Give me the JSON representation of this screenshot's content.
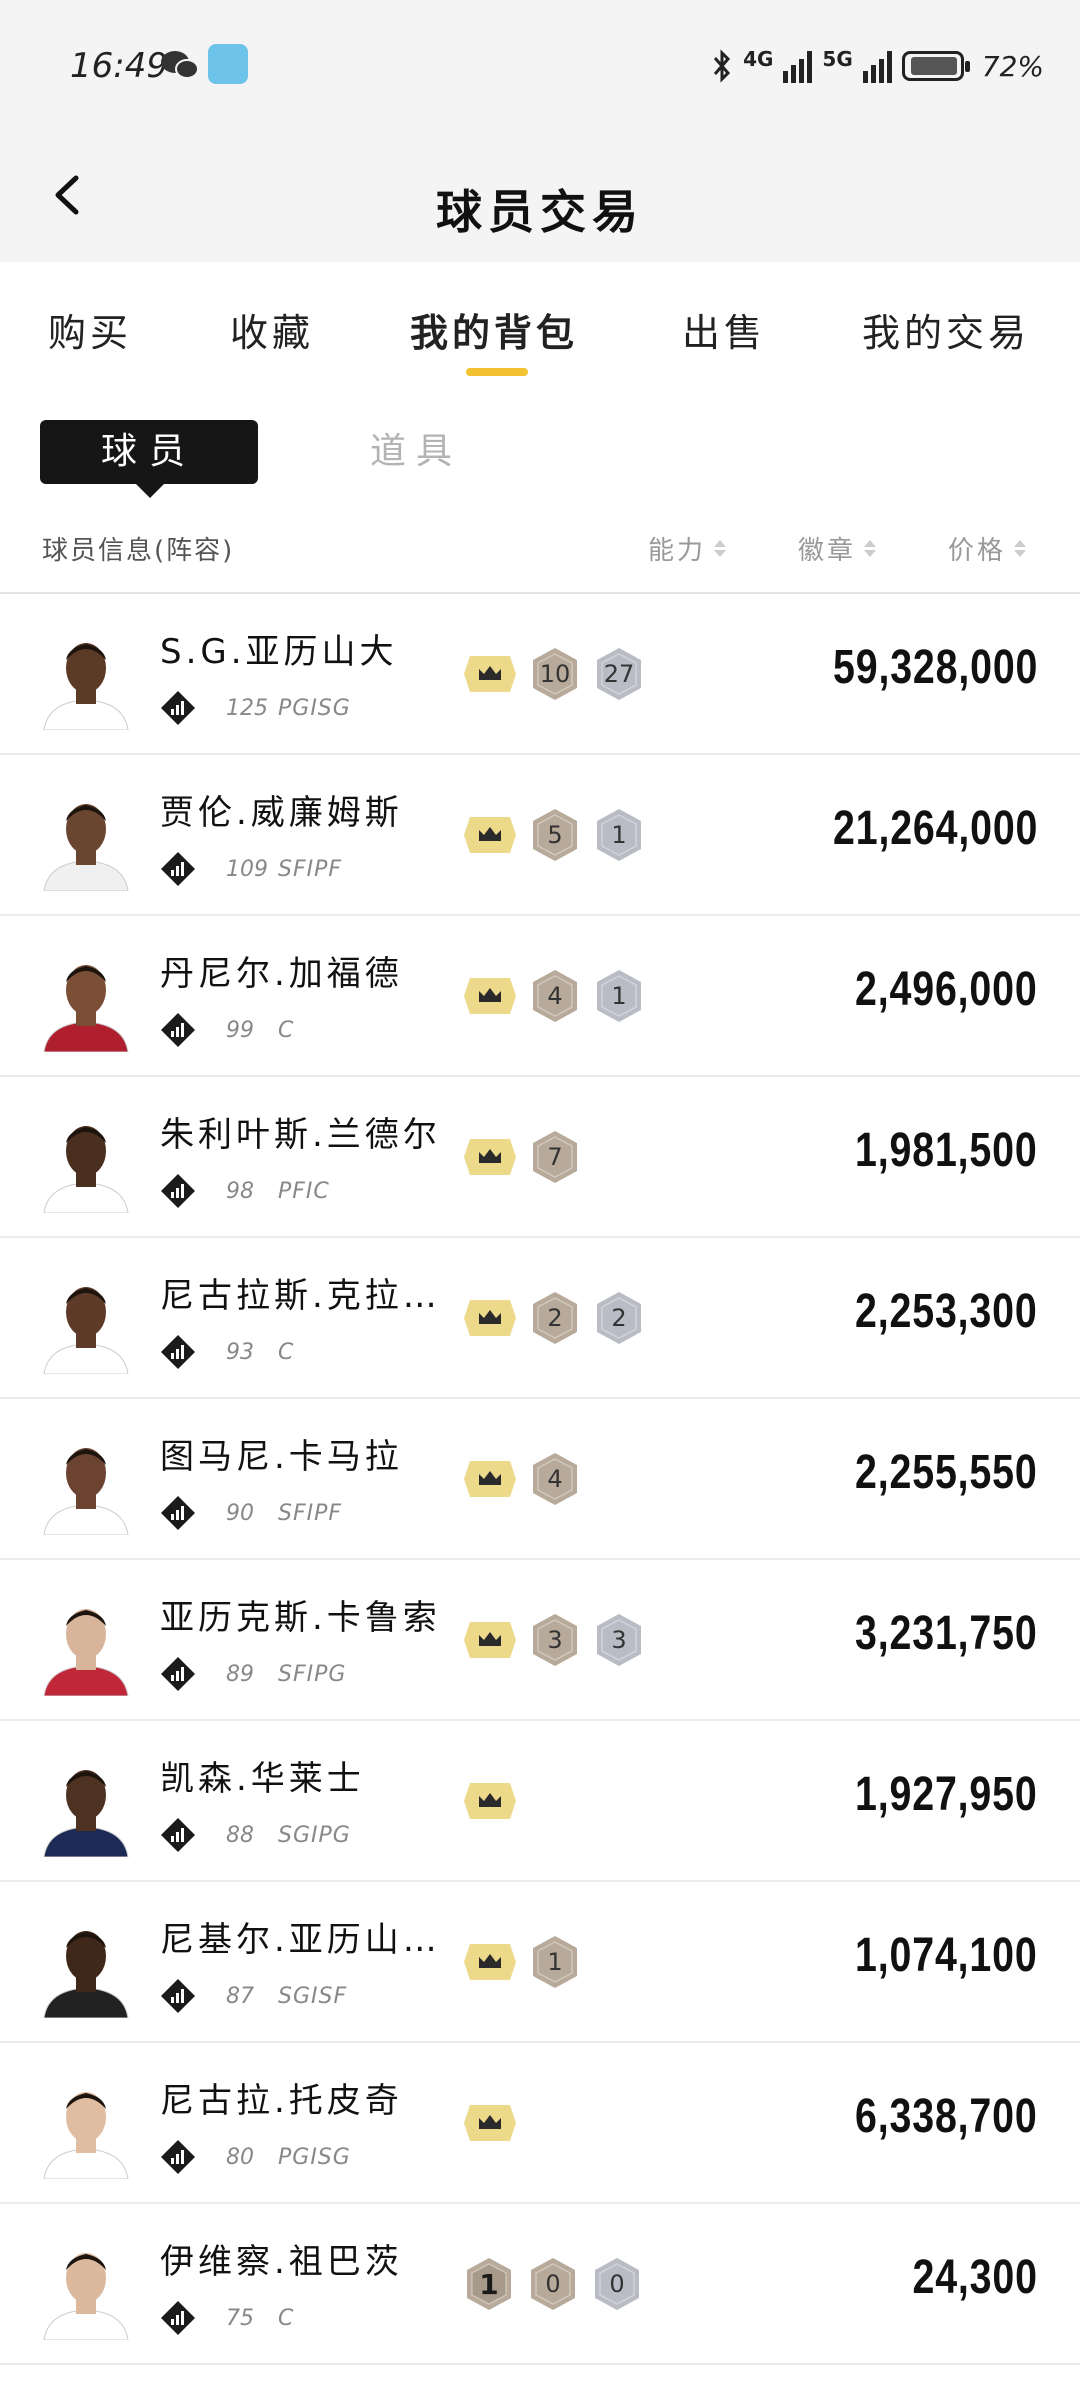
{
  "status_bar": {
    "time": "16:49",
    "net1": "4G",
    "net2": "5G",
    "battery": "72%"
  },
  "nav": {
    "title": "球员交易"
  },
  "tabs": [
    {
      "label": "购买"
    },
    {
      "label": "收藏"
    },
    {
      "label": "我的背包"
    },
    {
      "label": "出售"
    },
    {
      "label": "我的交易"
    }
  ],
  "segment": {
    "active": "球员",
    "inactive": "道具"
  },
  "columns": {
    "info": "球员信息(阵容)",
    "ability": "能力",
    "badge": "徽章",
    "price": "价格"
  },
  "colors": {
    "accent": "#f2c230",
    "crown_bg": "#ecd98a",
    "bronze_hex": "#b8aa9a",
    "silver_hex": "#b9bcc4"
  },
  "players": [
    {
      "name": "S.G.亚历山大",
      "ovr": "125",
      "pos": "PGISG",
      "price": "59,328,000",
      "badges": [
        {
          "type": "crown"
        },
        {
          "type": "bronze",
          "value": "10"
        },
        {
          "type": "silver",
          "value": "27"
        }
      ]
    },
    {
      "name": "贾伦.威廉姆斯",
      "ovr": "109",
      "pos": "SFIPF",
      "price": "21,264,000",
      "badges": [
        {
          "type": "crown"
        },
        {
          "type": "bronze",
          "value": "5"
        },
        {
          "type": "silver",
          "value": "1"
        }
      ]
    },
    {
      "name": "丹尼尔.加福德",
      "ovr": "99",
      "pos": "C",
      "price": "2,496,000",
      "badges": [
        {
          "type": "crown"
        },
        {
          "type": "bronze",
          "value": "4"
        },
        {
          "type": "silver",
          "value": "1"
        }
      ]
    },
    {
      "name": "朱利叶斯.兰德尔",
      "ovr": "98",
      "pos": "PFIC",
      "price": "1,981,500",
      "badges": [
        {
          "type": "crown"
        },
        {
          "type": "bronze",
          "value": "7"
        }
      ]
    },
    {
      "name": "尼古拉斯.克拉…",
      "ovr": "93",
      "pos": "C",
      "price": "2,253,300",
      "badges": [
        {
          "type": "crown"
        },
        {
          "type": "bronze",
          "value": "2"
        },
        {
          "type": "silver",
          "value": "2"
        }
      ]
    },
    {
      "name": "图马尼.卡马拉",
      "ovr": "90",
      "pos": "SFIPF",
      "price": "2,255,550",
      "badges": [
        {
          "type": "crown"
        },
        {
          "type": "bronze",
          "value": "4"
        }
      ]
    },
    {
      "name": "亚历克斯.卡鲁索",
      "ovr": "89",
      "pos": "SFIPG",
      "price": "3,231,750",
      "badges": [
        {
          "type": "crown"
        },
        {
          "type": "bronze",
          "value": "3"
        },
        {
          "type": "silver",
          "value": "3"
        }
      ]
    },
    {
      "name": "凯森.华莱士",
      "ovr": "88",
      "pos": "SGIPG",
      "price": "1,927,950",
      "badges": [
        {
          "type": "crown"
        }
      ]
    },
    {
      "name": "尼基尔.亚历山…",
      "ovr": "87",
      "pos": "SGISF",
      "price": "1,074,100",
      "badges": [
        {
          "type": "crown"
        },
        {
          "type": "bronze",
          "value": "1"
        }
      ]
    },
    {
      "name": "尼古拉.托皮奇",
      "ovr": "80",
      "pos": "PGISG",
      "price": "6,338,700",
      "badges": [
        {
          "type": "crown"
        }
      ]
    },
    {
      "name": "伊维察.祖巴茨",
      "ovr": "75",
      "pos": "C",
      "price": "24,300",
      "badges": [
        {
          "type": "dark",
          "value": "1"
        },
        {
          "type": "bronze",
          "value": "0"
        },
        {
          "type": "silver",
          "value": "0"
        }
      ]
    }
  ]
}
